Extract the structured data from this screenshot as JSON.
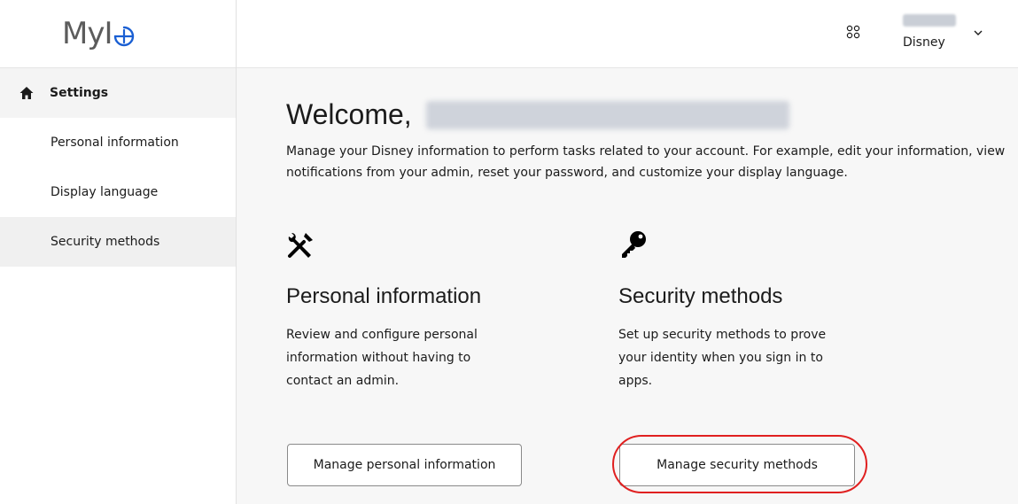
{
  "brand": {
    "logo_text": "MyI",
    "accent": "#1a5fd3"
  },
  "topbar": {
    "apps_icon": "apps-grid-icon",
    "account_org": "Disney"
  },
  "sidebar": {
    "header_label": "Settings",
    "items": [
      {
        "label": "Personal information",
        "active": false
      },
      {
        "label": "Display language",
        "active": false
      },
      {
        "label": "Security methods",
        "active": true
      }
    ]
  },
  "main": {
    "welcome": "Welcome,",
    "intro": "Manage your Disney information to perform tasks related to your account. For example, edit your information, view notifications from your admin, reset your password, and customize your display language.",
    "cards": [
      {
        "icon": "tools-icon",
        "title": "Personal information",
        "description": "Review and configure personal information without having to contact an admin.",
        "button": "Manage personal information"
      },
      {
        "icon": "key-icon",
        "title": "Security methods",
        "description": "Set up security methods to prove your identity when you sign in to apps.",
        "button": "Manage security methods"
      }
    ]
  },
  "annotation": {
    "highlight_color": "#e02020"
  }
}
